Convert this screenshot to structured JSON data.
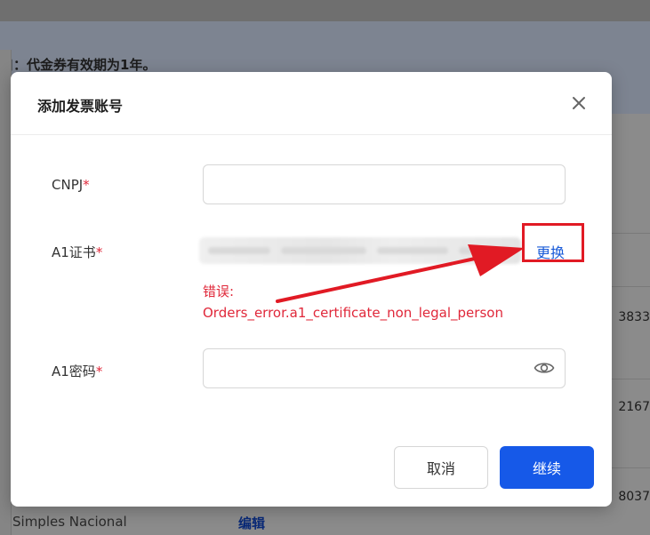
{
  "background": {
    "notice": "口：代金券有效期为1年。",
    "side_numbers": [
      "3833",
      "2167",
      "8037"
    ],
    "bottom_row": {
      "text": "Simples Nacional",
      "link": "编辑"
    }
  },
  "modal": {
    "title": "添加发票账号",
    "fields": {
      "cnpj": {
        "label": "CNPJ",
        "required_mark": "*",
        "value": "",
        "placeholder": ""
      },
      "certificate": {
        "label": "A1证书",
        "required_mark": "*",
        "replace_label": "更换",
        "error_title": "错误:",
        "error_message": "Orders_error.a1_certificate_non_legal_person"
      },
      "password": {
        "label": "A1密码",
        "required_mark": "*",
        "value": "",
        "placeholder": ""
      }
    },
    "buttons": {
      "cancel": "取消",
      "continue": "继续"
    }
  },
  "icons": {
    "close": "close-icon",
    "password_toggle": "eye-icon",
    "annotation_arrow": "red-arrow"
  },
  "colors": {
    "primary": "#1659e8",
    "error": "#e0283a",
    "highlight": "#e11a24",
    "link": "#1a5bd8"
  }
}
